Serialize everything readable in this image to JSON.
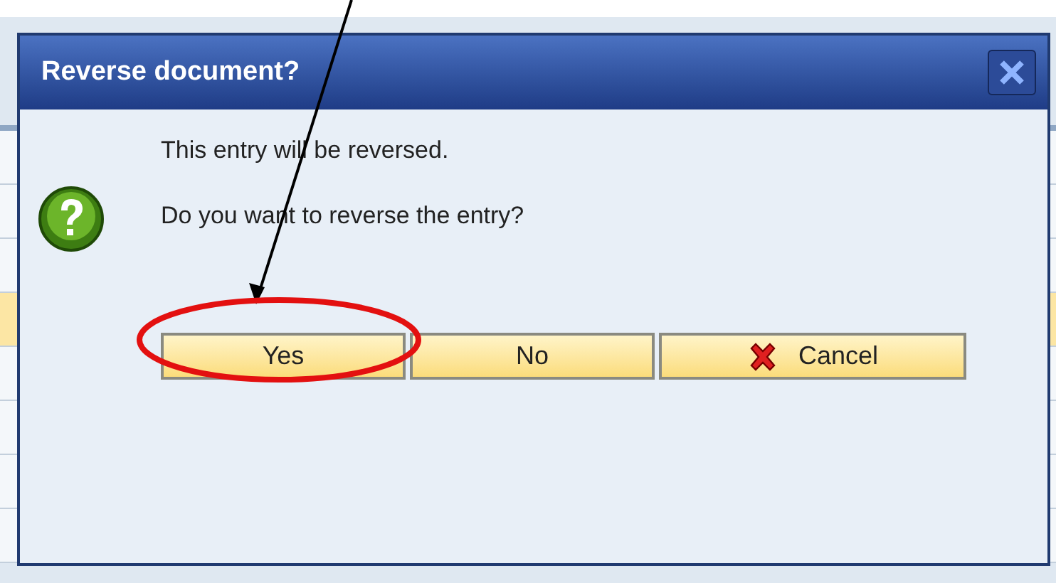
{
  "dialog": {
    "title": "Reverse document?",
    "messages": [
      "This entry will be reversed.",
      "Do you want to reverse the entry?"
    ],
    "buttons": [
      {
        "label": "Yes",
        "kind": "plain",
        "circled": true
      },
      {
        "label": "No",
        "kind": "plain",
        "circled": false
      },
      {
        "label": "Cancel",
        "kind": "cancel",
        "circled": false
      }
    ]
  },
  "background_table": {
    "rows": [
      {
        "highlighted": false
      },
      {
        "highlighted": false
      },
      {
        "highlighted": false
      },
      {
        "highlighted": true
      },
      {
        "highlighted": false
      },
      {
        "highlighted": false
      },
      {
        "highlighted": false
      },
      {
        "highlighted": false
      }
    ]
  }
}
